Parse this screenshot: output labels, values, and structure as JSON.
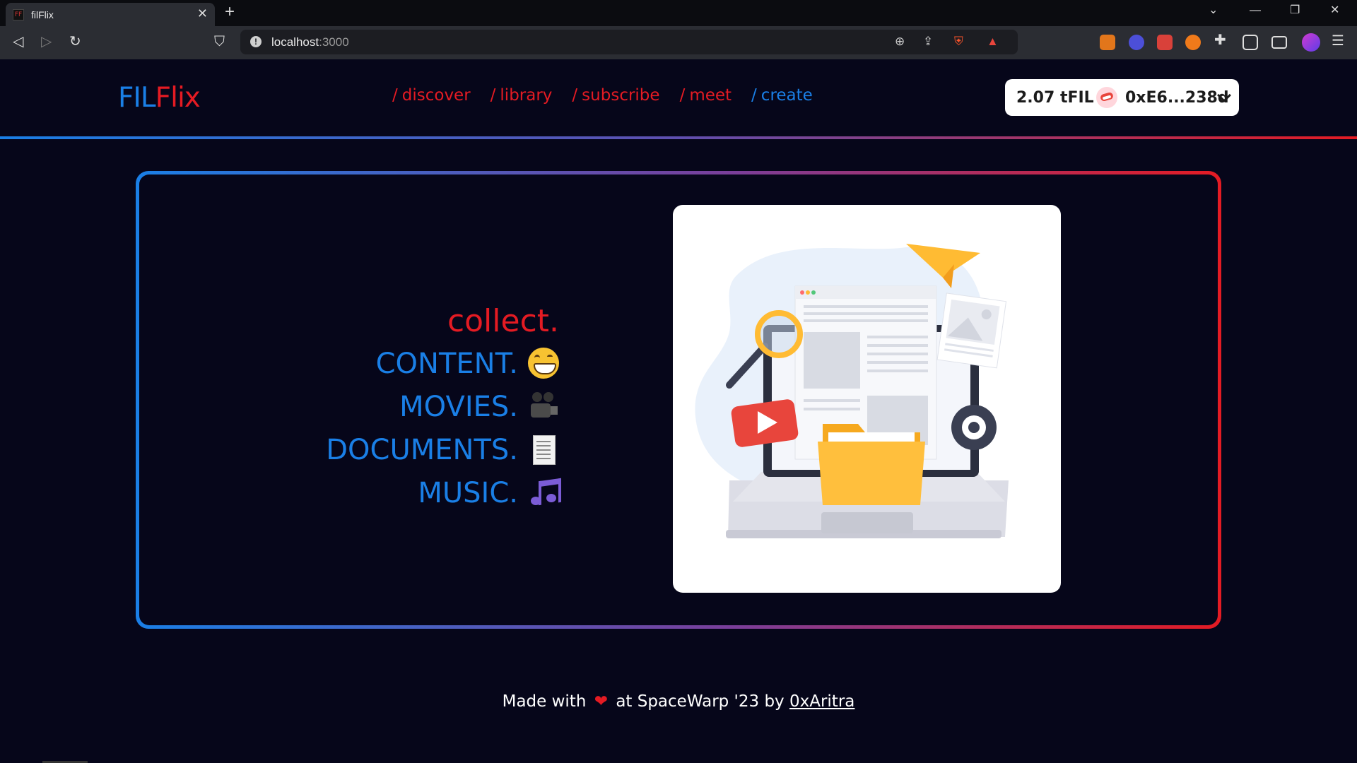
{
  "browser": {
    "tab_title": "filFlix",
    "tab_favicon_text": "FF",
    "url_host": "localhost",
    "url_port": ":3000",
    "icons": [
      "back-icon",
      "forward-icon",
      "reload-icon",
      "bookmark-icon",
      "site-info-icon",
      "zoom-icon",
      "share-icon",
      "brave-shields-icon",
      "brave-rewards-icon",
      "metamask-icon",
      "extension-icon",
      "puzzle-icon",
      "sidebar-icon",
      "wallet-icon",
      "profile-icon",
      "menu-icon"
    ]
  },
  "app": {
    "logo_part1": "FIL",
    "logo_part2": "Flix",
    "nav": [
      {
        "slash": "/",
        "label": "discover"
      },
      {
        "slash": "/",
        "label": "library"
      },
      {
        "slash": "/",
        "label": "subscribe"
      },
      {
        "slash": "/",
        "label": "meet"
      },
      {
        "slash": "/",
        "label": "create"
      }
    ],
    "wallet": {
      "balance": "2.07 tFIL",
      "address": "0xE6...238d"
    },
    "colors": {
      "blue": "#1a7fe6",
      "red": "#e41b23",
      "background": "#06061a"
    }
  },
  "hero": {
    "headline": "collect.",
    "rows": [
      {
        "label": "CONTENT.",
        "emoji": "grinning-face-emoji"
      },
      {
        "label": "MOVIES.",
        "emoji": "movie-camera-emoji"
      },
      {
        "label": "DOCUMENTS.",
        "emoji": "page-emoji"
      },
      {
        "label": "MUSIC.",
        "emoji": "musical-notes-emoji"
      }
    ]
  },
  "footer": {
    "prefix": "Made with",
    "middle": "at SpaceWarp '23 by",
    "author": "0xAritra"
  }
}
